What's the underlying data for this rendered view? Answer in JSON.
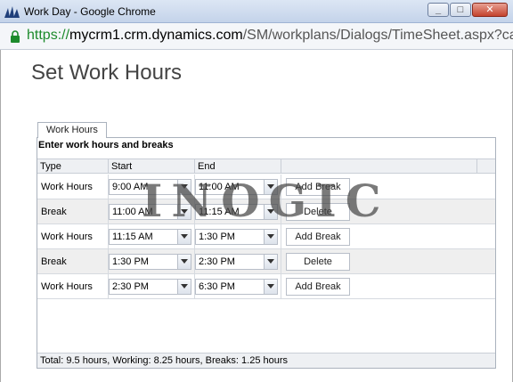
{
  "window": {
    "title": "Work Day - Google Chrome",
    "url_scheme": "https://",
    "url_host": "mycrm1.crm.dynamics.com",
    "url_path": "/SM/workplans/Dialogs/TimeSheet.aspx?calendarTy"
  },
  "page": {
    "title": "Set Work Hours",
    "tab_label": "Work Hours",
    "heading": "Enter work hours and breaks"
  },
  "grid": {
    "columns": [
      "Type",
      "Start",
      "End"
    ],
    "rows": [
      {
        "type": "Work Hours",
        "start": "9:00 AM",
        "end": "11:00 AM",
        "action": "Add Break"
      },
      {
        "type": "Break",
        "start": "11:00 AM",
        "end": "11:15 AM",
        "action": "Delete"
      },
      {
        "type": "Work Hours",
        "start": "11:15 AM",
        "end": "1:30 PM",
        "action": "Add Break"
      },
      {
        "type": "Break",
        "start": "1:30 PM",
        "end": "2:30 PM",
        "action": "Delete"
      },
      {
        "type": "Work Hours",
        "start": "2:30 PM",
        "end": "6:30 PM",
        "action": "Add Break"
      }
    ]
  },
  "footer": {
    "summary": "Total: 9.5 hours, Working: 8.25 hours, Breaks: 1.25 hours"
  },
  "watermark": "INOGIC",
  "icons": {
    "app": "dynamics-logo-icon",
    "lock": "lock-icon",
    "dropdown": "chevron-down-icon"
  },
  "colors": {
    "secure_scheme": "#1d8b2c",
    "close_button": "#c4432d"
  }
}
